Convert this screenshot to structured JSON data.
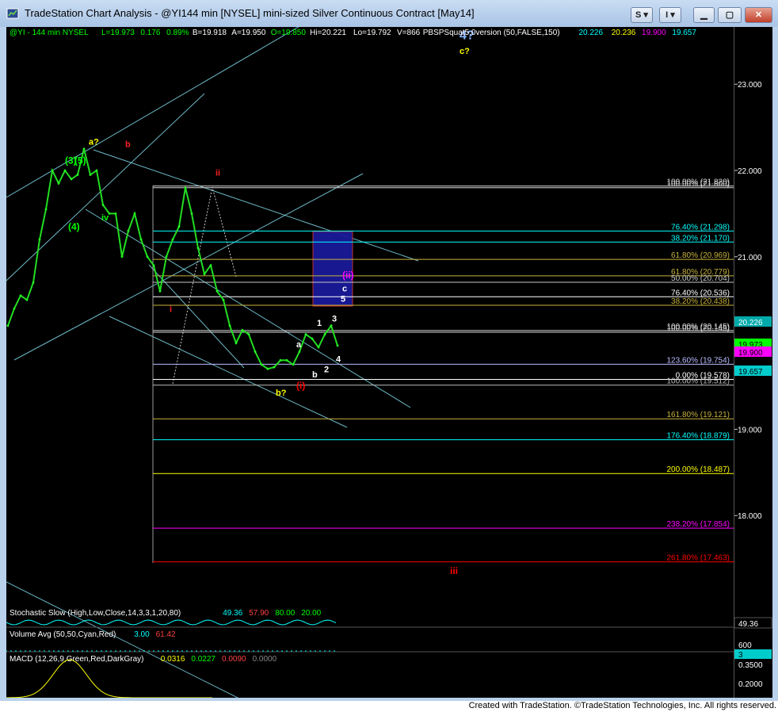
{
  "window": {
    "title": "TradeStation Chart Analysis - @YI144 min [NYSEL] mini-sized Silver Continuous Contract [May14]",
    "buttons": [
      "S",
      "I"
    ]
  },
  "header": {
    "segments": [
      {
        "text": "@YI - 144 min  NYSEL",
        "color": "#00ff00"
      },
      {
        "text": "L=19.973",
        "color": "#00ff00"
      },
      {
        "text": "0.176",
        "color": "#00ff00"
      },
      {
        "text": "0.89%",
        "color": "#00ff00"
      },
      {
        "text": "B=19.918",
        "color": "#ffffff"
      },
      {
        "text": "A=19.950",
        "color": "#ffffff"
      },
      {
        "text": "O=19.850",
        "color": "#00ff00"
      },
      {
        "text": "Hi=20.221",
        "color": "#ffffff"
      },
      {
        "text": "Lo=19.792",
        "color": "#ffffff"
      },
      {
        "text": "V=866",
        "color": "#ffffff"
      },
      {
        "text": "PBSPSquat5.0version (50,FALSE,150)",
        "color": "#ffffff"
      },
      {
        "text": "20.226",
        "color": "#00ffff"
      },
      {
        "text": "20.236",
        "color": "#ffff00"
      },
      {
        "text": "19.900",
        "color": "#ff00ff"
      },
      {
        "text": "19.657",
        "color": "#00ffff"
      }
    ]
  },
  "chart_data": {
    "type": "line",
    "symbol": "@YI",
    "interval": "144 min",
    "ylim": [
      17.3,
      23.3
    ],
    "y_ticks": [
      "23.000",
      "22.000",
      "21.000",
      "19.000",
      "18.000"
    ],
    "price_series": [
      20.2,
      20.4,
      20.55,
      20.5,
      20.7,
      21.2,
      21.55,
      22.0,
      21.85,
      22.0,
      21.9,
      21.95,
      22.25,
      21.95,
      22.0,
      21.6,
      21.5,
      21.5,
      21.0,
      21.3,
      21.5,
      21.2,
      21.0,
      20.9,
      20.6,
      21.0,
      21.2,
      21.35,
      21.8,
      21.5,
      21.1,
      20.8,
      20.9,
      20.6,
      20.5,
      20.2,
      20.0,
      20.15,
      20.1,
      19.9,
      19.75,
      19.7,
      19.72,
      19.8,
      19.8,
      19.75,
      19.9,
      20.1,
      20.05,
      19.95,
      20.1,
      20.2,
      19.97
    ],
    "fib_levels": [
      {
        "label": "100.00% (21.820)",
        "value": 21.82,
        "color": "#d8d8d8"
      },
      {
        "label": "100.00% (21.800)",
        "value": 21.8,
        "color": "#d8d8d8"
      },
      {
        "label": "76.40% (21.298)",
        "value": 21.298,
        "color": "#00ffff"
      },
      {
        "label": "38.20% (21.170)",
        "value": 21.17,
        "color": "#00ffff"
      },
      {
        "label": "61.80% (20.969)",
        "value": 20.969,
        "color": "#c8b23c"
      },
      {
        "label": "61.80% (20.779)",
        "value": 20.779,
        "color": "#c8b23c"
      },
      {
        "label": "50.00% (20.704)",
        "value": 20.704,
        "color": "#c8c8c8"
      },
      {
        "label": "76.40% (20.536)",
        "value": 20.536,
        "color": "#ffffff"
      },
      {
        "label": "38.20% (20.438)",
        "value": 20.438,
        "color": "#c8b23c"
      },
      {
        "label": "100.00% (20.145)",
        "value": 20.145,
        "color": "#d8d8d8"
      },
      {
        "label": "100.00% (20.145)",
        "value": 20.125,
        "color": "#d8d8d8"
      },
      {
        "label": "123.60% (19.754)",
        "value": 19.754,
        "color": "#bbbbff"
      },
      {
        "label": "0.00% (19.578)",
        "value": 19.578,
        "color": "#ffffff"
      },
      {
        "label": "100.00% (19.512)",
        "value": 19.512,
        "color": "#bbbbbb"
      },
      {
        "label": "161.80% (19.121)",
        "value": 19.121,
        "color": "#c8b23c"
      },
      {
        "label": "176.40% (18.879)",
        "value": 18.879,
        "color": "#00ffff"
      },
      {
        "label": "200.00% (18.487)",
        "value": 18.487,
        "color": "#ffff00"
      },
      {
        "label": "238.20% (17.854)",
        "value": 17.854,
        "color": "#ff00ff"
      },
      {
        "label": "261.80% (17.463)",
        "value": 17.463,
        "color": "#ff0000"
      }
    ],
    "wave_labels": [
      {
        "text": "4?",
        "color": "#8ab4ff",
        "price": 23.52
      },
      {
        "text": "c?",
        "color": "#ffff00",
        "price": 23.35
      },
      {
        "text": "a?",
        "color": "#ffff00",
        "price": 22.3
      },
      {
        "text": "b",
        "color": "#ff2020",
        "price": 22.27
      },
      {
        "text": "ii",
        "color": "#ff2020",
        "price": 21.94
      },
      {
        "text": "iv",
        "color": "#00ff00",
        "price": 21.42
      },
      {
        "text": "(3)",
        "color": "#00ff00",
        "price": 22.08
      },
      {
        "text": "(5)",
        "color": "#00ff00",
        "price": 22.08
      },
      {
        "text": "(4)",
        "color": "#00ff00",
        "price": 21.31
      },
      {
        "text": "i",
        "color": "#ff2020",
        "price": 20.36
      },
      {
        "text": "(ii)",
        "color": "#ff00ff",
        "price": 20.75
      },
      {
        "text": "c",
        "color": "#ffffff",
        "price": 20.6
      },
      {
        "text": "5",
        "color": "#ffffff",
        "price": 20.48
      },
      {
        "text": "3",
        "color": "#ffffff",
        "price": 20.25
      },
      {
        "text": "1",
        "color": "#ffffff",
        "price": 20.2
      },
      {
        "text": "a",
        "color": "#ffffff",
        "price": 19.95
      },
      {
        "text": "4",
        "color": "#ffffff",
        "price": 19.78
      },
      {
        "text": "2",
        "color": "#ffffff",
        "price": 19.66
      },
      {
        "text": "b",
        "color": "#ffffff",
        "price": 19.6
      },
      {
        "text": "(i)",
        "color": "#ff0000",
        "price": 19.47
      },
      {
        "text": "b?",
        "color": "#ffff00",
        "price": 19.39
      },
      {
        "text": "iii",
        "color": "#ff0000",
        "price": 17.32
      }
    ],
    "axis_badges": [
      {
        "text": "20.226",
        "bg": "#00aaaa",
        "fg": "#ffffff"
      },
      {
        "text": "19.973",
        "bg": "#00ff00",
        "fg": "#000000"
      },
      {
        "text": "19.900",
        "bg": "#ff00ff",
        "fg": "#000000"
      },
      {
        "text": "19.657",
        "bg": "#00cccc",
        "fg": "#000000"
      }
    ],
    "indicators": [
      {
        "name": "stochastic",
        "legend": "Stochastic Slow (High,Low,Close,14,3,3,1,20,80)",
        "values": [
          "49.36",
          "57.90",
          "80.00",
          "20.00"
        ],
        "value_colors": [
          "#00ffff",
          "#ff4040",
          "#00ff00",
          "#00ff00"
        ],
        "axis_value": "49.36"
      },
      {
        "name": "volume",
        "legend": "Volume Avg (50,50,Cyan,Red)",
        "values": [
          "3.00",
          "61.42"
        ],
        "value_colors": [
          "#00ffff",
          "#ff4040"
        ],
        "axis_value": "600",
        "axis_value2": "3"
      },
      {
        "name": "macd",
        "legend": "MACD (12,26,9,Green,Red,DarkGray)",
        "values": [
          "0.0316",
          "0.0227",
          "0.0090",
          "0.0000"
        ],
        "value_colors": [
          "#ffff00",
          "#00ff00",
          "#ff4040",
          "#888888"
        ],
        "axis_ticks": [
          "0.3500",
          "0.2000"
        ]
      }
    ]
  },
  "footer": {
    "credit": "Created with TradeStation. ©TradeStation Technologies, Inc. All rights reserved."
  }
}
